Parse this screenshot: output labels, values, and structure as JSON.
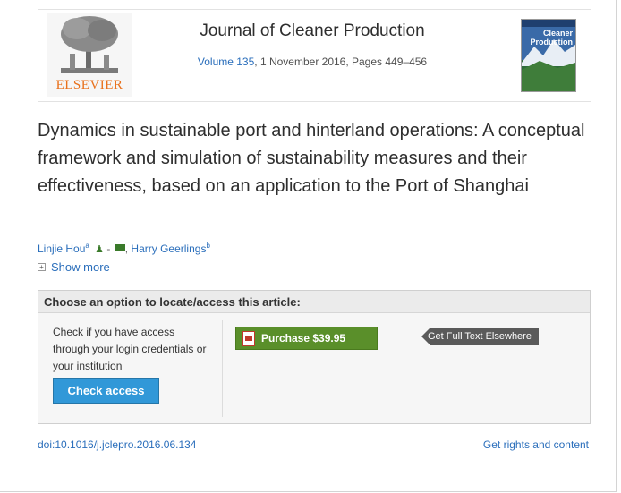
{
  "journal": {
    "publisher": "ELSEVIER",
    "title": "Journal of Cleaner Production",
    "volume_link": "Volume 135",
    "issue_details": ", 1 November 2016, Pages 449–456",
    "cover_title_line1": "Cleaner",
    "cover_title_line2": "Production"
  },
  "article": {
    "title": "Dynamics in sustainable port and hinterland operations: A conceptual framework and simulation of sustainability measures and their effectiveness, based on an application to the Port of Shanghai",
    "authors": [
      {
        "name": "Linjie Hou",
        "sup": "a"
      },
      {
        "name": "Harry Geerlings",
        "sup": "b"
      }
    ],
    "separator": ",",
    "show_more": "Show more",
    "doi": "doi:10.1016/j.jclepro.2016.06.134",
    "rights": "Get rights and content"
  },
  "access": {
    "header": "Choose an option to locate/access this article:",
    "check_text": "Check if you have access through your login credentials or your institution",
    "check_button": "Check access",
    "purchase_button": "Purchase $39.95",
    "fulltext_button": "Get Full Text Elsewhere"
  },
  "colors": {
    "accent_link": "#2a6ebb",
    "publisher_orange": "#e9711c",
    "check_blue": "#3198d8",
    "purchase_green": "#5a8f2a",
    "fulltext_gray": "#5a5a5a"
  },
  "icons": {
    "author": "person-icon",
    "email": "mail-icon",
    "expand": "plus-icon",
    "pdf": "pdf-icon"
  }
}
